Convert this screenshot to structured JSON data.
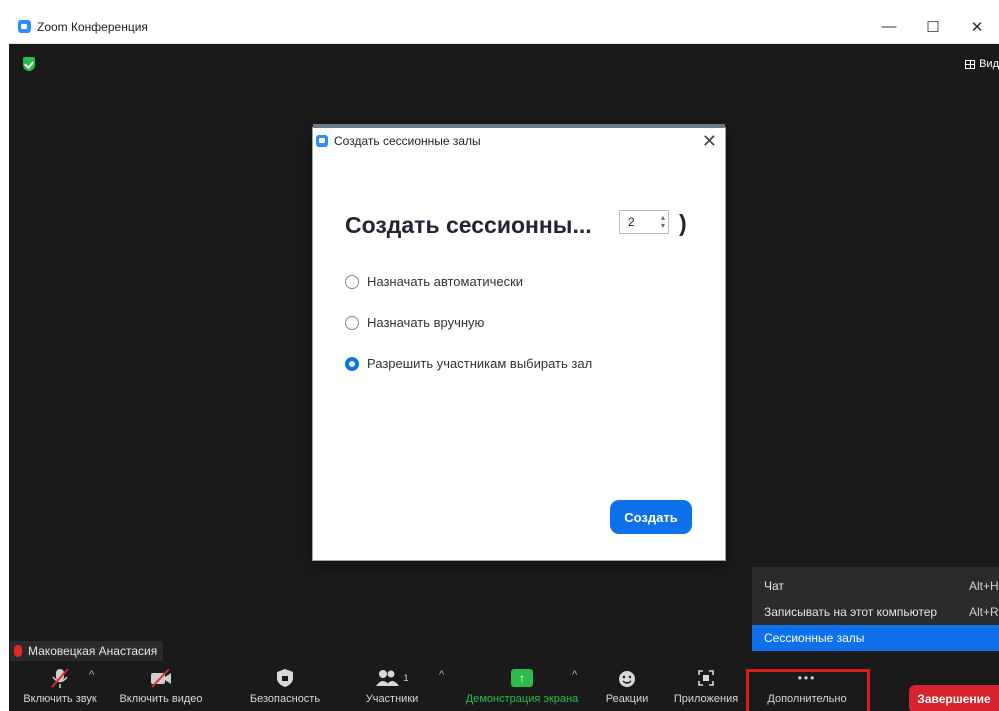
{
  "window": {
    "title": "Zoom Конференция",
    "view_label": "Вид",
    "controls": {
      "minimize": "—",
      "maximize": "☐",
      "close": "✕"
    }
  },
  "dialog": {
    "title": "Создать сессионные залы",
    "close": "✕",
    "heading": "Создать сессионны...",
    "room_count": "2",
    "heading_suffix": ")",
    "options": [
      {
        "label": "Назначать автоматически",
        "checked": false
      },
      {
        "label": "Назначать вручную",
        "checked": false
      },
      {
        "label": "Разрешить участникам выбирать зал",
        "checked": true
      }
    ],
    "create_label": "Создать"
  },
  "more_menu": {
    "items": [
      {
        "label": "Чат",
        "shortcut": "Alt+H"
      },
      {
        "label": "Записывать на этот компьютер",
        "shortcut": "Alt+R"
      },
      {
        "label": "Сессионные залы",
        "shortcut": ""
      }
    ]
  },
  "participant": {
    "name": "Маковецкая Анастасия"
  },
  "toolbar": {
    "audio": "Включить звук",
    "video": "Включить видео",
    "security": "Безопасность",
    "participants": "Участники",
    "participant_count": "1",
    "share": "Демонстрация экрана",
    "reactions": "Реакции",
    "apps": "Приложения",
    "more": "Дополнительно",
    "more_icon": "•••",
    "end": "Завершение"
  },
  "colors": {
    "accent": "#0e71eb",
    "share_green": "#2bbd4a",
    "end_red": "#d9232e",
    "highlight_red": "#e01b1b",
    "muted_red": "#e02828"
  }
}
